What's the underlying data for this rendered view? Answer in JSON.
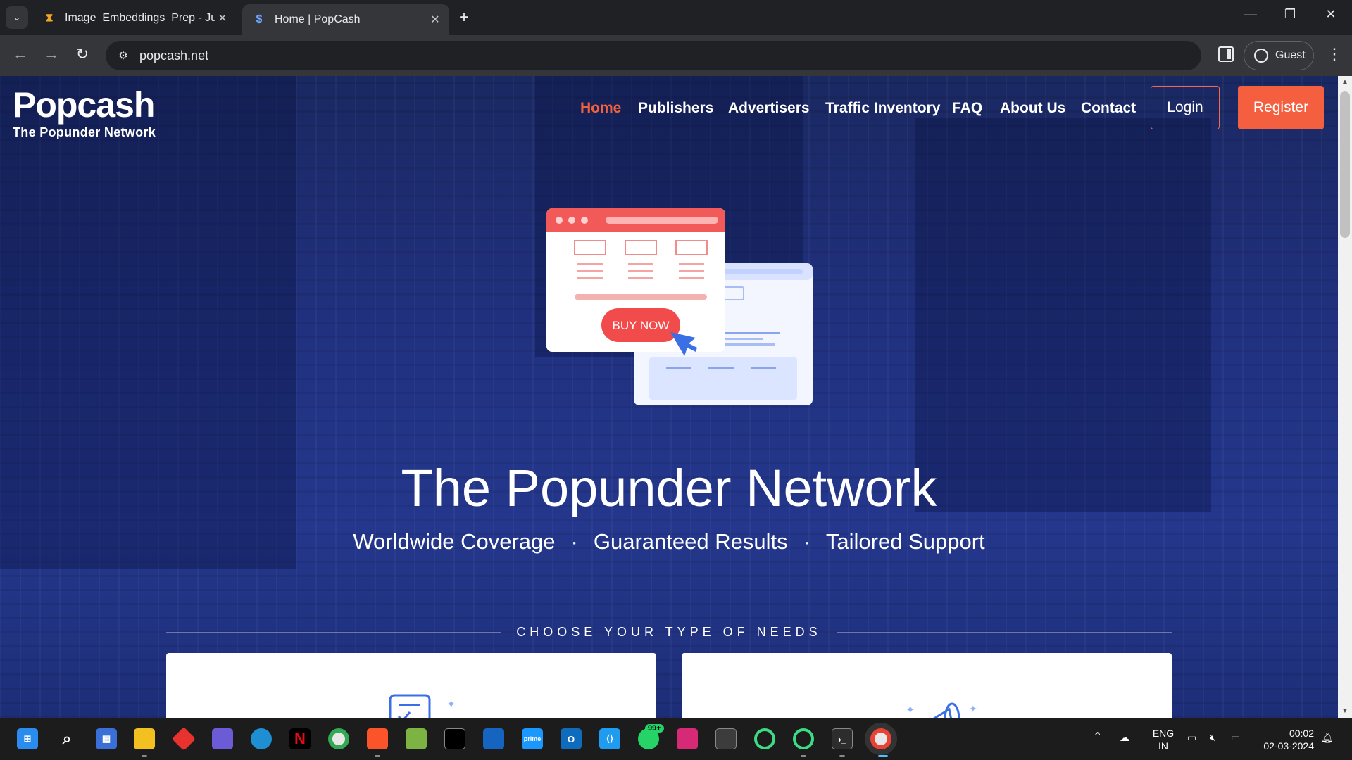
{
  "browser": {
    "tabs": [
      {
        "title": "Image_Embeddings_Prep - Jupy",
        "icon": "hourglass-icon",
        "active": false
      },
      {
        "title": "Home | PopCash",
        "icon": "dollar-icon",
        "active": true
      }
    ],
    "new_tab": "+",
    "url": "popcash.net",
    "profile": "Guest"
  },
  "site": {
    "brand": "Popcash",
    "tagline": "The Popunder Network",
    "nav": [
      "Home",
      "Publishers",
      "Advertisers",
      "Traffic Inventory",
      "FAQ",
      "About Us",
      "Contact"
    ],
    "login": "Login",
    "register": "Register",
    "illustration_button": "BUY NOW",
    "hero_title": "The Popunder Network",
    "hero_points": [
      "Worldwide Coverage",
      "Guaranteed Results",
      "Tailored Support"
    ],
    "section_heading": "CHOOSE YOUR TYPE OF NEEDS"
  },
  "colors": {
    "accent": "#f4603f",
    "hero_bg": "#213180"
  },
  "taskbar": {
    "icons": [
      "windows-start-icon",
      "search-icon",
      "store-icon",
      "file-explorer-icon",
      "app-red-icon",
      "copilot-icon",
      "edge-icon",
      "netflix-icon",
      "chrome-icon",
      "brave-icon",
      "notepad-icon",
      "terminal-icon",
      "app-blue-icon",
      "prime-video-icon",
      "outlook-icon",
      "vscode-icon",
      "whatsapp-icon",
      "instagram-icon",
      "app-window-icon",
      "app-green-ring-icon",
      "app-green-ring-2-icon",
      "terminal-2-icon",
      "chrome-active-icon"
    ],
    "whatsapp_badge": "99+",
    "lang_top": "ENG",
    "lang_bottom": "IN",
    "time": "00:02",
    "date": "02-03-2024"
  }
}
